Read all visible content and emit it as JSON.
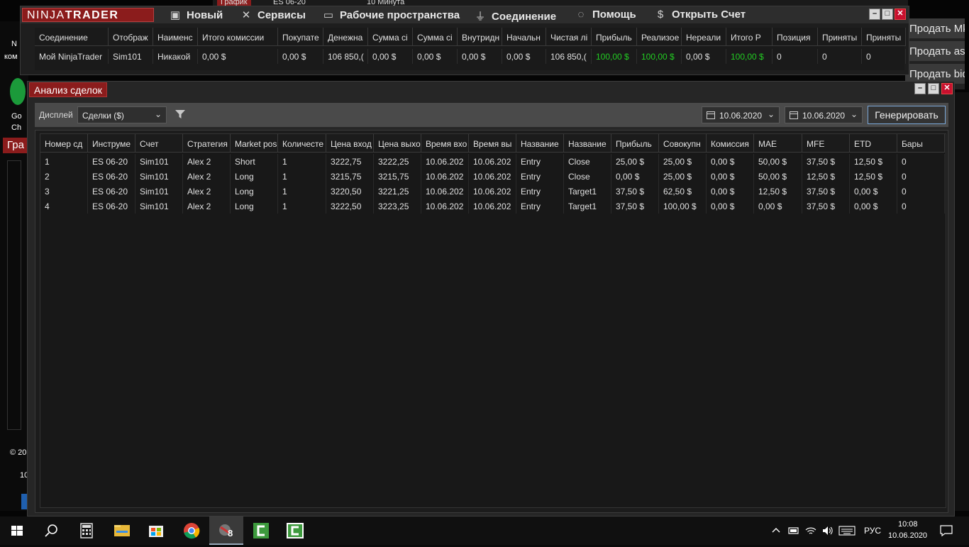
{
  "background": {
    "chart_tab": "График",
    "instrument": "ES 06-20",
    "interval": "10 Минута",
    "right_buttons": [
      "Продать Mk",
      "Продать asl",
      "Продать bid"
    ],
    "left_texts": [
      "Гра",
      "© 20",
      "10",
      "Go",
      "Ch",
      "N",
      "ком"
    ]
  },
  "control_center": {
    "logo_a": "NINJA",
    "logo_b": "TRADER",
    "menu": [
      {
        "icon": "new-icon",
        "label": "Новый"
      },
      {
        "icon": "tools-icon",
        "label": "Сервисы"
      },
      {
        "icon": "workspace-icon",
        "label": "Рабочие пространства"
      },
      {
        "icon": "plug-icon",
        "label": "Соединение"
      },
      {
        "icon": "help-icon",
        "label": "Помощь"
      },
      {
        "icon": "dollar-icon",
        "label": "Открыть Счет"
      }
    ],
    "grid": {
      "headers": [
        "Соединение",
        "Отображ",
        "Наименс",
        "Итого комиссии",
        "Покупате",
        "Денежна",
        "Сумма сі",
        "Сумма сі",
        "Внутридн",
        "Начальн",
        "Чистая лі",
        "Прибыль",
        "Реализое",
        "Нереали",
        "Итого Р",
        "Позиция",
        "Приняты",
        "Приняты"
      ],
      "row": [
        "Мой NinjaTrader",
        "Sim101",
        "Никакой",
        "0,00 $",
        "0,00 $",
        "106 850,(",
        "0,00 $",
        "0,00 $",
        "0,00 $",
        "0,00 $",
        "106 850,(",
        "100,00 $",
        "100,00 $",
        "0,00 $",
        "100,00 $",
        "0",
        "0",
        "0"
      ],
      "sort_indicator": "▲"
    }
  },
  "trade_window": {
    "title": "Анализ сделок",
    "toolbar": {
      "display_label": "Дисплей",
      "display_value": "Сделки ($)",
      "date_from": "10.06.2020",
      "date_to": "10.06.2020",
      "generate": "Генерировать"
    },
    "headers": [
      "Номер сд",
      "Инструме",
      "Счет",
      "Стратегия",
      "Market pos",
      "Количесте",
      "Цена вход",
      "Цена выхо",
      "Время вхо",
      "Время вы",
      "Название",
      "Название",
      "Прибыль",
      "Совокупн",
      "Комиссия",
      "MAE",
      "MFE",
      "ETD",
      "Бары"
    ],
    "rows": [
      [
        "1",
        "ES 06-20",
        "Sim101",
        "Alex 2",
        "Short",
        "1",
        "3222,75",
        "3222,25",
        "10.06.202",
        "10.06.202",
        "Entry",
        "Close",
        "25,00 $",
        "25,00 $",
        "0,00 $",
        "50,00 $",
        "37,50 $",
        "12,50 $",
        "0"
      ],
      [
        "2",
        "ES 06-20",
        "Sim101",
        "Alex 2",
        "Long",
        "1",
        "3215,75",
        "3215,75",
        "10.06.202",
        "10.06.202",
        "Entry",
        "Close",
        "0,00 $",
        "25,00 $",
        "0,00 $",
        "50,00 $",
        "12,50 $",
        "12,50 $",
        "0"
      ],
      [
        "3",
        "ES 06-20",
        "Sim101",
        "Alex 2",
        "Long",
        "1",
        "3220,50",
        "3221,25",
        "10.06.202",
        "10.06.202",
        "Entry",
        "Target1",
        "37,50 $",
        "62,50 $",
        "0,00 $",
        "12,50 $",
        "37,50 $",
        "0,00 $",
        "0"
      ],
      [
        "4",
        "ES 06-20",
        "Sim101",
        "Alex 2",
        "Long",
        "1",
        "3222,50",
        "3223,25",
        "10.06.202",
        "10.06.202",
        "Entry",
        "Target1",
        "37,50 $",
        "100,00 $",
        "0,00 $",
        "0,00 $",
        "37,50 $",
        "0,00 $",
        "0"
      ]
    ]
  },
  "taskbar": {
    "apps": [
      "start-icon",
      "search-icon",
      "calculator-icon",
      "explorer-icon",
      "store-icon",
      "chrome-icon",
      "ninjatrader-icon",
      "camtasia-icon",
      "camtasia-recorder-icon"
    ],
    "ninja_badge": "8",
    "language": "РУС",
    "time": "10:08",
    "date": "10.06.2020"
  },
  "colors": {
    "accent_red": "#8b1c1c",
    "profit_green": "#22cc22",
    "generate_border": "#7aa7d8"
  }
}
